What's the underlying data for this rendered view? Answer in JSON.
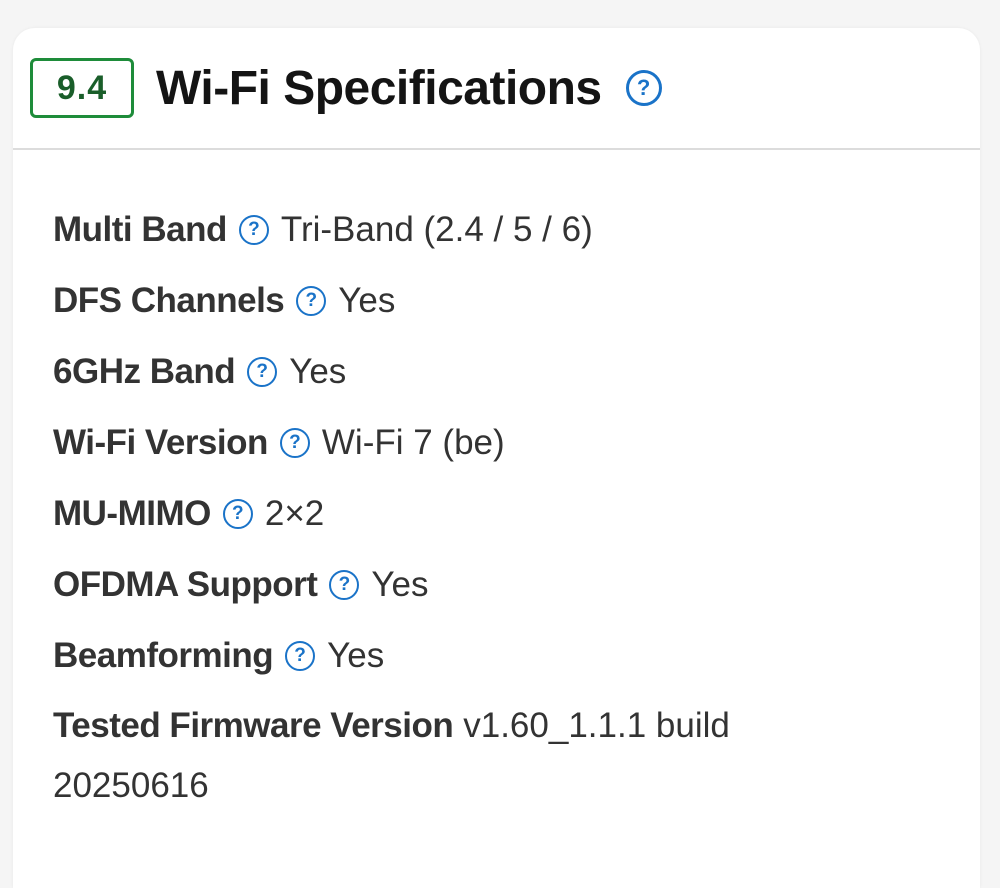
{
  "header": {
    "score": "9.4",
    "title": "Wi-Fi Specifications",
    "help_icon": "question-circle-icon"
  },
  "colors": {
    "score_border": "#1e8c3a",
    "score_text": "#1a5e2a",
    "help_icon": "#1a73c8",
    "text": "#333333"
  },
  "specs": [
    {
      "label": "Multi Band",
      "value": "Tri-Band (2.4 / 5 / 6)",
      "has_help": true
    },
    {
      "label": "DFS Channels",
      "value": "Yes",
      "has_help": true
    },
    {
      "label": "6GHz Band",
      "value": "Yes",
      "has_help": true
    },
    {
      "label": "Wi-Fi Version",
      "value": "Wi-Fi 7 (be)",
      "has_help": true
    },
    {
      "label": "MU-MIMO",
      "value": "2×2",
      "has_help": true
    },
    {
      "label": "OFDMA Support",
      "value": "Yes",
      "has_help": true
    },
    {
      "label": "Beamforming",
      "value": "Yes",
      "has_help": true
    },
    {
      "label": "Tested Firmware Version",
      "value": "v1.60_1.1.1 build 20250616",
      "has_help": false
    }
  ]
}
